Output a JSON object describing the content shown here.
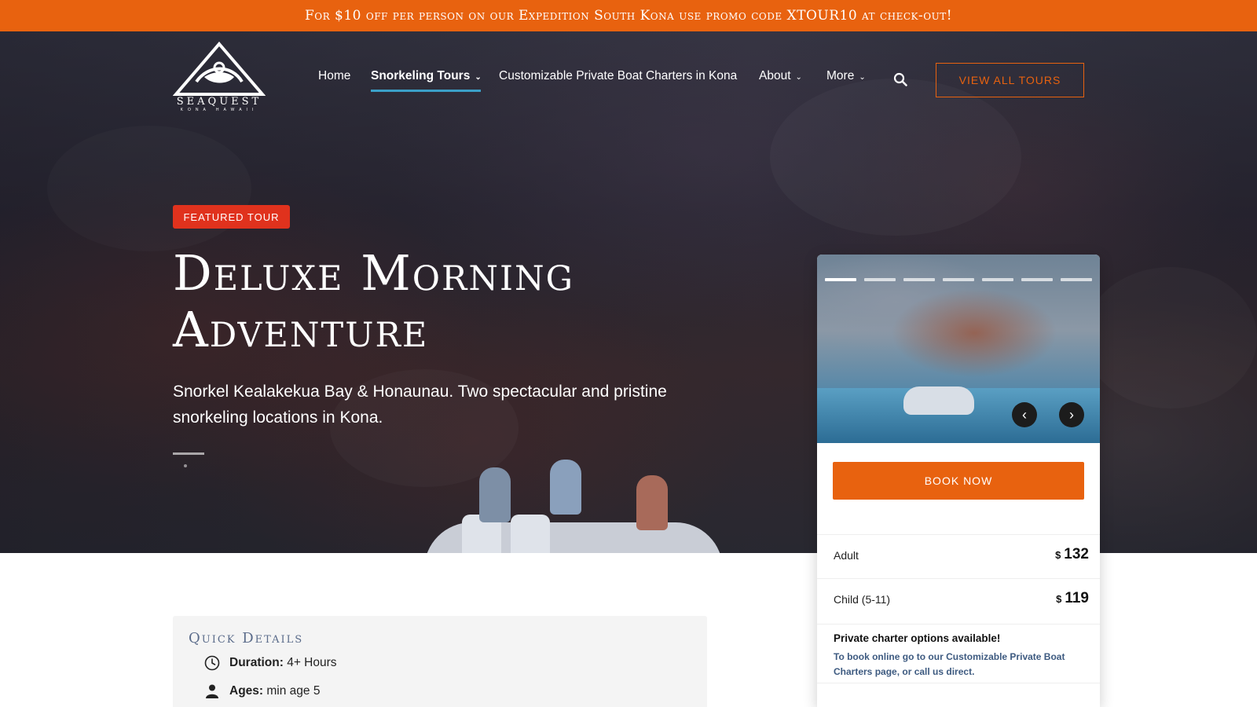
{
  "promo": {
    "text": "For $10 off per person on our Expedition South Kona use promo code XTOUR10 at check-out!"
  },
  "logo": {
    "name": "SEAQUEST",
    "tagline": "KONA HAWAII"
  },
  "nav": {
    "items": [
      {
        "label": "Home"
      },
      {
        "label": "Snorkeling Tours"
      },
      {
        "label": "Customizable Private Boat Charters in Kona"
      },
      {
        "label": "About"
      },
      {
        "label": "More"
      }
    ],
    "view_all": "VIEW ALL TOURS"
  },
  "hero": {
    "badge": "FEATURED TOUR",
    "title_line1": "Deluxe Morning",
    "title_line2": "Adventure",
    "description": "Snorkel Kealakekua Bay & Honaunau. Two spectacular and pristine snorkeling locations in Kona."
  },
  "card": {
    "book_now": "BOOK NOW",
    "prices": [
      {
        "label": "Adult",
        "currency": "$",
        "amount": "132"
      },
      {
        "label": "Child (5-11)",
        "currency": "$",
        "amount": "119"
      }
    ],
    "charter_title": "Private charter options available!",
    "charter_text": "To book online go to our Customizable Private Boat Charters page, or call us direct.",
    "slides_count": 7,
    "prev": "‹",
    "next": "›"
  },
  "quick_details": {
    "title": "Quick Details",
    "duration_label": "Duration:",
    "duration_value": "4+ Hours",
    "ages_label": "Ages:",
    "ages_value": "min age 5"
  },
  "colors": {
    "accent": "#e8620f",
    "badge": "#e0321d",
    "nav_underline": "#3ba0c8"
  },
  "icons": [
    "search-icon",
    "chevron-down-icon",
    "clock-icon",
    "person-icon",
    "arrow-left-icon",
    "arrow-right-icon"
  ]
}
